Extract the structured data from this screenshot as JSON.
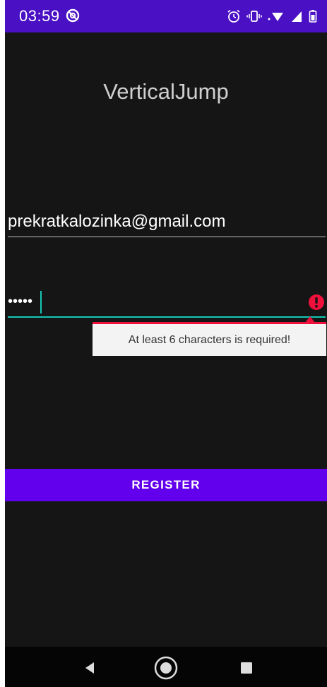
{
  "status_bar": {
    "time": "03:59",
    "background": "#4a10c4"
  },
  "app": {
    "title": "VerticalJump"
  },
  "email_field": {
    "value": "prekratkalozinka@gmail.com"
  },
  "password_field": {
    "masked_value": "•••••"
  },
  "error": {
    "message": "At least 6 characters is required!",
    "icon": "error-exclamation-icon",
    "color": "#f0103c"
  },
  "register_button": {
    "label": "REGISTER",
    "color": "#6200ee"
  },
  "colors": {
    "accent": "#14c8b5",
    "background": "#151515"
  },
  "nav_bar": {
    "icons": [
      "back-icon",
      "home-icon",
      "recents-icon"
    ]
  }
}
